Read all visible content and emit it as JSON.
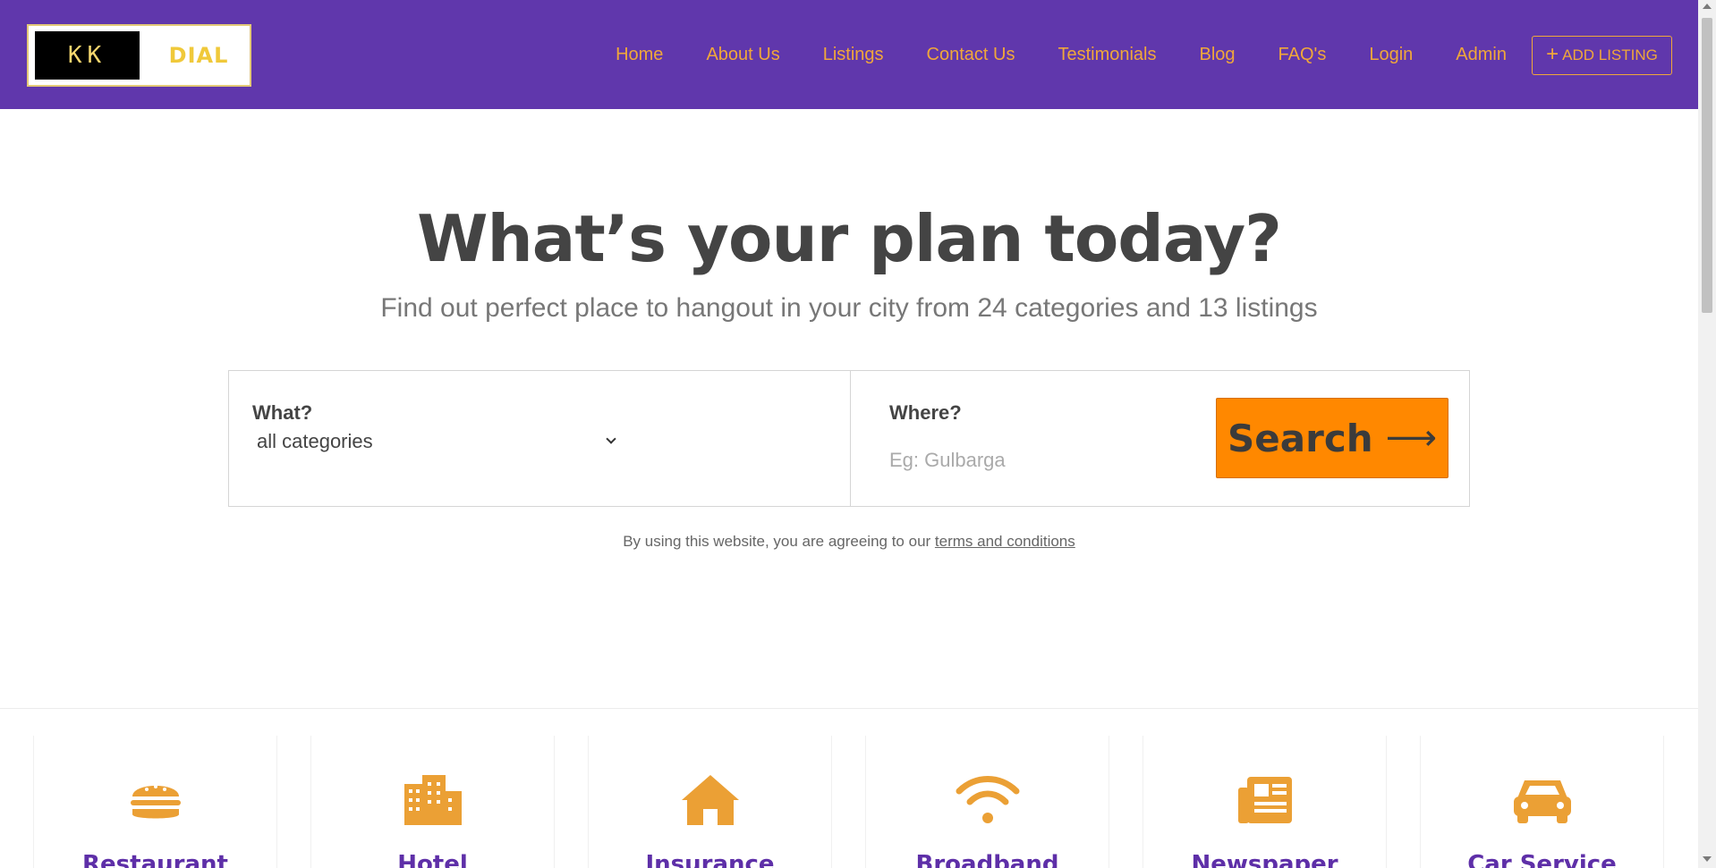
{
  "brand": {
    "logo_left": "KK",
    "logo_right": "DIAL"
  },
  "nav": {
    "items": [
      "Home",
      "About Us",
      "Listings",
      "Contact Us",
      "Testimonials",
      "Blog",
      "FAQ's",
      "Login",
      "Admin"
    ],
    "add_listing": "ADD LISTING"
  },
  "hero": {
    "title": "What’s your plan today?",
    "subtitle": "Find out perfect place to hangout in your city from 24 categories and 13 listings"
  },
  "search": {
    "what_label": "What?",
    "what_value": "all categories",
    "where_label": "Where?",
    "where_placeholder": "Eg: Gulbarga",
    "button_label": "Search",
    "button_arrow": "⟶"
  },
  "terms": {
    "prefix": "By using this website, you are agreeing to our ",
    "link": "terms and conditions"
  },
  "categories": [
    {
      "label": "Restaurant",
      "icon": "burger-icon"
    },
    {
      "label": "Hotel",
      "icon": "building-icon"
    },
    {
      "label": "Insurance Company",
      "icon": "house-icon"
    },
    {
      "label": "Broadband Provider",
      "icon": "wifi-icon"
    },
    {
      "label": "Newspaper Provider",
      "icon": "newspaper-icon"
    },
    {
      "label": "Car Service",
      "icon": "car-icon"
    }
  ],
  "colors": {
    "header_bg": "#6037ac",
    "nav_text": "#f0a73a",
    "search_button": "#ff8800",
    "category_icon": "#eba035",
    "category_label": "#5e2fa8"
  }
}
